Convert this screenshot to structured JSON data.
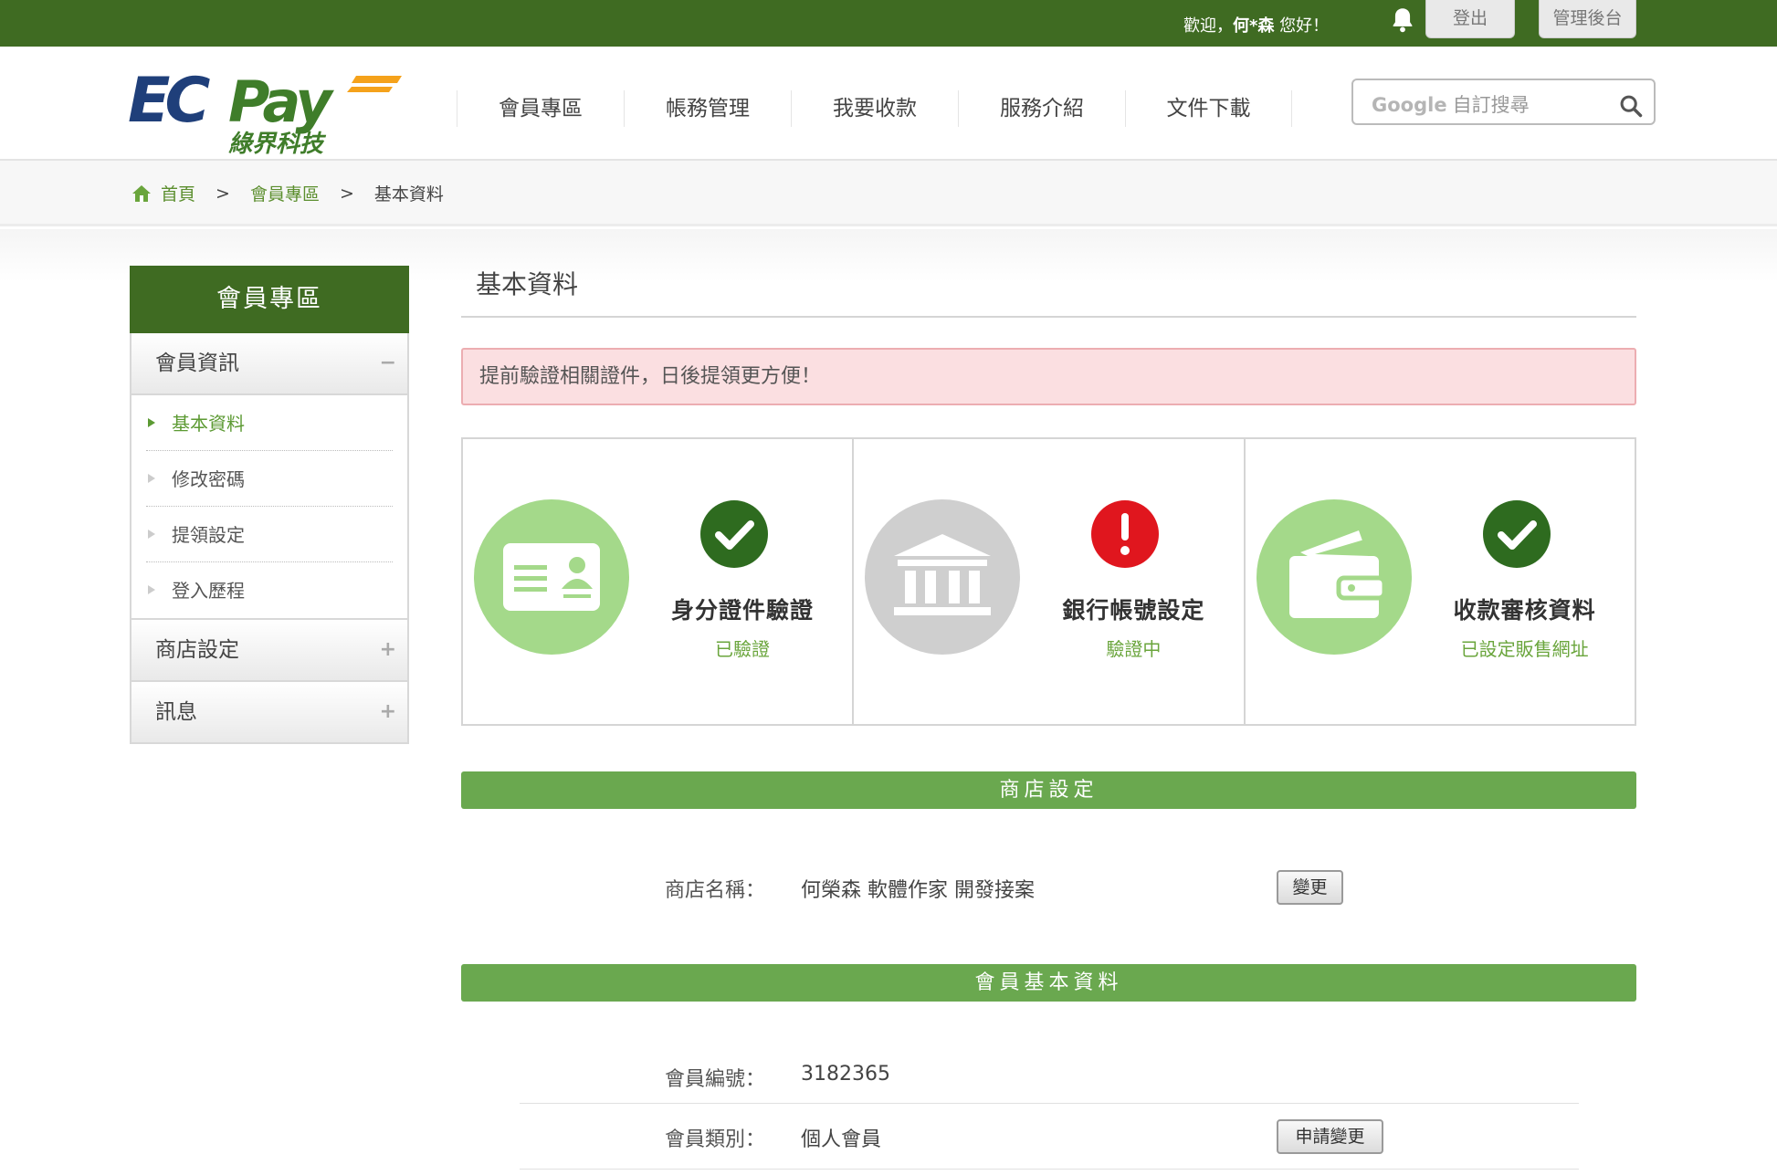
{
  "topbar": {
    "welcome_prefix": "歡迎，",
    "user_name": "何*森",
    "welcome_suffix": " 您好！",
    "logout": "登出",
    "admin": "管理後台"
  },
  "header": {
    "logo_main": "ECPay",
    "logo_sub": "綠界科技",
    "nav": [
      "會員專區",
      "帳務管理",
      "我要收款",
      "服務介紹",
      "文件下載"
    ],
    "search_brand": "Google",
    "search_placeholder": "自訂搜尋"
  },
  "breadcrumb": {
    "home": "首頁",
    "member": "會員專區",
    "current": "基本資料",
    "sep": ">"
  },
  "sidebar": {
    "title": "會員專區",
    "sections": [
      {
        "label": "會員資訊",
        "toggle": "−",
        "expanded": true
      },
      {
        "label": "商店設定",
        "toggle": "+",
        "expanded": false
      },
      {
        "label": "訊息",
        "toggle": "+",
        "expanded": false
      }
    ],
    "links": [
      "基本資料",
      "修改密碼",
      "提領設定",
      "登入歷程"
    ]
  },
  "main": {
    "title": "基本資料",
    "alert": "提前驗證相關證件，日後提領更方便！",
    "cards": [
      {
        "title": "身分證件驗證",
        "status": "已驗證",
        "icon": "id-card-icon",
        "status_icon": "check-icon",
        "circle_color": "#a4d98a",
        "status_color": "#2e6b1f"
      },
      {
        "title": "銀行帳號設定",
        "status": "驗證中",
        "icon": "bank-icon",
        "status_icon": "exclamation-icon",
        "circle_color": "#cfcfcf",
        "status_color": "#e0161e"
      },
      {
        "title": "收款審核資料",
        "status": "已設定販售網址",
        "icon": "wallet-icon",
        "status_icon": "check-icon",
        "circle_color": "#a4d98a",
        "status_color": "#2e6b1f"
      }
    ],
    "store_section": {
      "title": "商店設定",
      "label": "商店名稱：",
      "value": "何榮森 軟體作家 開發接案",
      "button": "變更"
    },
    "member_section": {
      "title": "會員基本資料",
      "rows": [
        {
          "label": "會員編號：",
          "value": "3182365"
        },
        {
          "label": "會員類別：",
          "value": "個人會員",
          "button": "申請變更"
        }
      ]
    }
  },
  "colors": {
    "brand_green": "#3f6b22",
    "section_green": "#6aa84f",
    "link_green": "#5c9a33",
    "alert_bg": "#fbdfe1"
  }
}
